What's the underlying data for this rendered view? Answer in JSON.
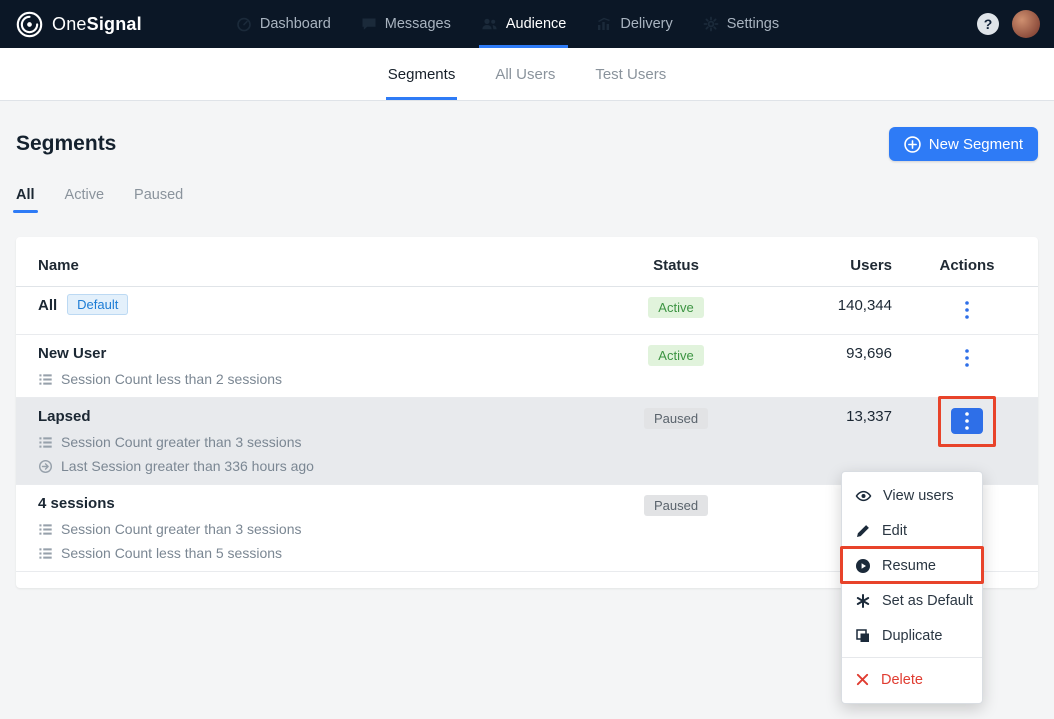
{
  "topnav": {
    "brand": {
      "one": "One",
      "signal": "Signal"
    },
    "items": [
      {
        "label": "Dashboard",
        "icon": "dashboard-icon",
        "active": false
      },
      {
        "label": "Messages",
        "icon": "messages-icon",
        "active": false
      },
      {
        "label": "Audience",
        "icon": "audience-icon",
        "active": true
      },
      {
        "label": "Delivery",
        "icon": "delivery-icon",
        "active": false
      },
      {
        "label": "Settings",
        "icon": "settings-icon",
        "active": false
      }
    ],
    "help_label": "?"
  },
  "subnav": {
    "tabs": [
      {
        "label": "Segments",
        "active": true
      },
      {
        "label": "All Users",
        "active": false
      },
      {
        "label": "Test Users",
        "active": false
      }
    ]
  },
  "page": {
    "title": "Segments",
    "new_segment_button": "New Segment",
    "filter_tabs": [
      {
        "label": "All",
        "active": true
      },
      {
        "label": "Active",
        "active": false
      },
      {
        "label": "Paused",
        "active": false
      }
    ]
  },
  "table": {
    "headers": [
      "Name",
      "Status",
      "Users",
      "Actions"
    ],
    "rows": [
      {
        "name": "All",
        "badge": "Default",
        "status": "Active",
        "status_type": "active",
        "users": "140,344",
        "highlighted": false,
        "criteria": []
      },
      {
        "name": "New User",
        "status": "Active",
        "status_type": "active",
        "users": "93,696",
        "highlighted": false,
        "criteria": [
          {
            "icon": "list-icon",
            "text": "Session Count less than 2 sessions"
          }
        ]
      },
      {
        "name": "Lapsed",
        "status": "Paused",
        "status_type": "paused",
        "users": "13,337",
        "highlighted": true,
        "criteria": [
          {
            "icon": "list-icon",
            "text": "Session Count greater than 3 sessions"
          },
          {
            "icon": "arrow-icon",
            "text": "Last Session greater than 336 hours ago"
          }
        ]
      },
      {
        "name": "4 sessions",
        "status": "Paused",
        "status_type": "paused",
        "users": "",
        "highlighted": false,
        "criteria": [
          {
            "icon": "list-icon",
            "text": "Session Count greater than 3 sessions"
          },
          {
            "icon": "list-icon",
            "text": "Session Count less than 5 sessions"
          }
        ]
      }
    ]
  },
  "menu": {
    "items": [
      {
        "label": "View users",
        "icon": "eye-icon"
      },
      {
        "label": "Edit",
        "icon": "pencil-icon"
      },
      {
        "label": "Resume",
        "icon": "play-icon",
        "boxed": true
      },
      {
        "label": "Set as Default",
        "icon": "asterisk-icon"
      },
      {
        "label": "Duplicate",
        "icon": "duplicate-icon"
      }
    ],
    "delete_item": {
      "label": "Delete",
      "icon": "x-icon"
    }
  },
  "colors": {
    "accent_blue": "#2e7bf6",
    "topbar": "#0b1726",
    "status_active_green": "#3c9442",
    "annotation": "#e8432a",
    "delete_red": "#e03c31"
  },
  "annotations": {
    "boxes": [
      "lapsed-actions-button",
      "resume-menu-item"
    ]
  }
}
